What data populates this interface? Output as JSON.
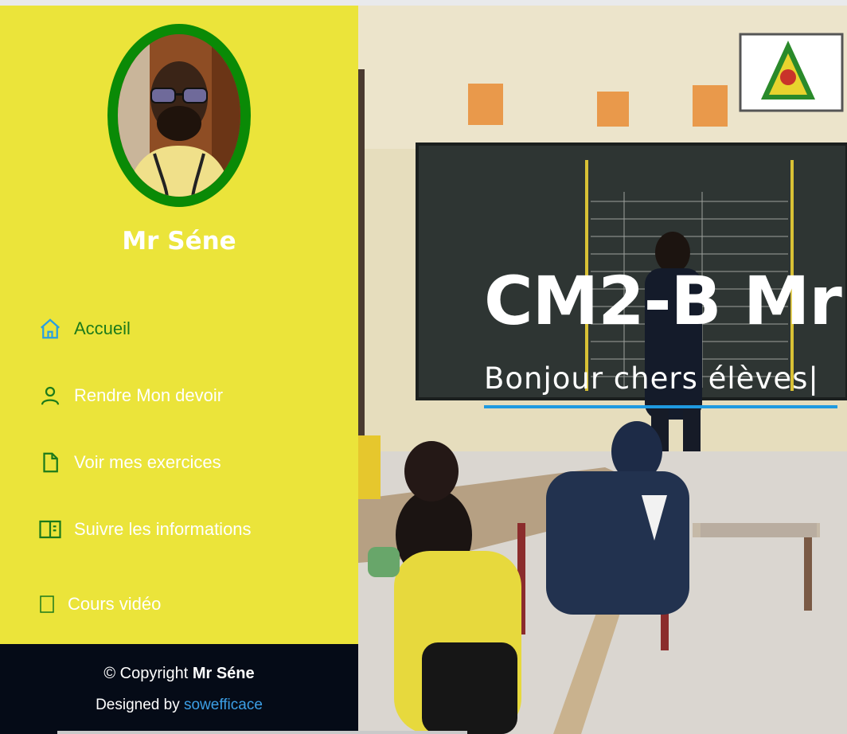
{
  "profile": {
    "name": "Mr Séne",
    "photo_icon": "teacher-photo"
  },
  "nav": [
    {
      "label": "Accueil",
      "icon": "home-icon",
      "active": true
    },
    {
      "label": "Rendre Mon devoir",
      "icon": "user-icon",
      "active": false
    },
    {
      "label": "Voir mes exercices",
      "icon": "file-icon",
      "active": false
    },
    {
      "label": "Suivre les informations",
      "icon": "book-open-icon",
      "active": false
    },
    {
      "label": "Cours vidéo",
      "icon": "video-icon",
      "active": false
    }
  ],
  "footer": {
    "copyright_prefix": "© Copyright",
    "copyright_name": "Mr Séne",
    "designed_prefix": "Designed by",
    "designed_link": "sowefficace"
  },
  "hero": {
    "title": "CM2-B Mr",
    "subtitle": "Bonjour chers élèves|"
  },
  "colors": {
    "sidebar_bg": "#ebe43a",
    "active_nav": "#1d7a1a",
    "footer_bg": "#050b17",
    "accent_blue": "#1f9ae0",
    "avatar_ring": "#0a8a06"
  }
}
